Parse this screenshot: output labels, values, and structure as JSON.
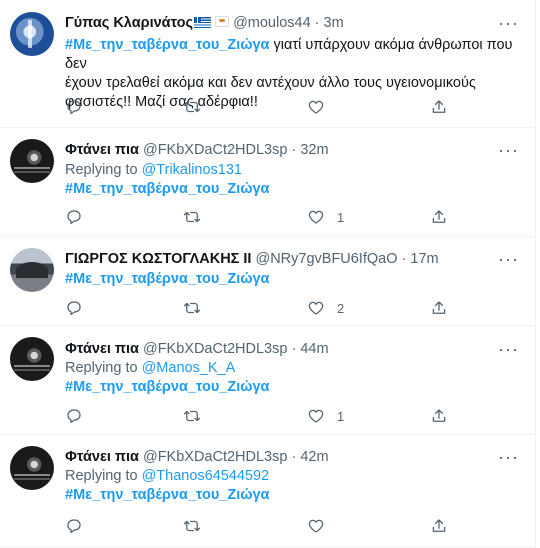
{
  "tweets": [
    {
      "name": "Γύπας Κλαρινάτος",
      "handle": "@moulos44",
      "time": "3m",
      "hashtag": "#Με_την_ταβέρνα_του_Ζιώγα",
      "line1_rest": " γιατί υπάρχουν ακόμα άνθρωποι που δεν",
      "line2": "έχουν τρελαθεί ακόμα και δεν αντέχουν άλλο τους υγειονομικούς",
      "line3": "φασιστές!! Μαζί σας αδέρφια!!",
      "like_count": ""
    },
    {
      "name": "Φτάνει πια",
      "handle": "@FKbXDaCt2HDL3sp",
      "time": "32m",
      "replying_label": "Replying to ",
      "replying_to": "@Trikalinos131",
      "hashtag": "#Με_την_ταβέρνα_του_Ζιώγα",
      "like_count": "1"
    },
    {
      "name": "ΓΙΩΡΓΟΣ ΚΩΣΤΟΓΛΑΚΗΣ ΙΙ",
      "handle": "@NRy7gvBFU6IfQaO",
      "time": "17m",
      "hashtag": "#Με_την_ταβέρνα_του_Ζιώγα",
      "like_count": "2"
    },
    {
      "name": "Φτάνει πια",
      "handle": "@FKbXDaCt2HDL3sp",
      "time": "44m",
      "replying_label": "Replying to ",
      "replying_to": "@Manos_K_A",
      "hashtag": "#Με_την_ταβέρνα_του_Ζιώγα",
      "like_count": "1"
    },
    {
      "name": "Φτάνει πια",
      "handle": "@FKbXDaCt2HDL3sp",
      "time": "42m",
      "replying_label": "Replying to ",
      "replying_to": "@Thanos64544592",
      "hashtag": "#Με_την_ταβέρνα_του_Ζιώγα",
      "like_count": ""
    }
  ],
  "separator_dot": " · ",
  "more_glyph": "···",
  "icons": [
    "reply-icon",
    "retweet-icon",
    "like-icon",
    "share-icon",
    "more-icon",
    "greek-flag-icon",
    "cyprus-flag-icon"
  ],
  "colors": {
    "accent": "#1d9bf0",
    "secondary_text": "#536471",
    "primary_text": "#0f1419",
    "divider": "#eff3f4"
  }
}
